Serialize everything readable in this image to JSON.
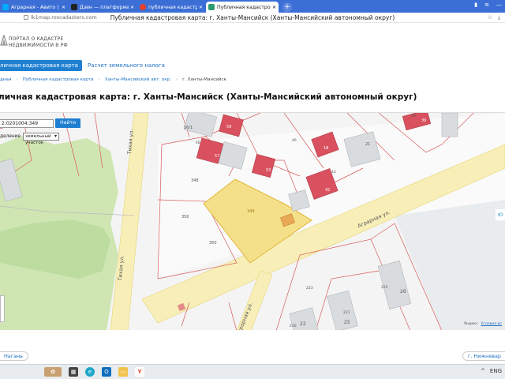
{
  "browser": {
    "tabs": [
      {
        "title": "Аграрная - Авито | Объя",
        "favicon_color": "#00aaff"
      },
      {
        "title": "Дзен — платформа для п",
        "favicon_color": "#222222"
      },
      {
        "title": "публичная кадастровая к",
        "favicon_color": "#e8402c"
      },
      {
        "title": "Публичная кадастровая",
        "favicon_color": "#2e9a6f"
      }
    ],
    "new_tab_symbol": "+",
    "url": "lk1map.roscadasters.com",
    "page_title": "Публичная кадастровая карта: г. Ханты-Мансийск (Ханты-Мансийский автономный округ)"
  },
  "site": {
    "logo_text_line1": "ПОРТАЛ О КАДАСТРЕ",
    "logo_text_line2": "НЕДВИЖИМОСТИ В РФ",
    "nav_active": "личная кадастровая карта",
    "nav_link": "Расчет земельного налога",
    "breadcrumbs": [
      "дная",
      "Публичная кадастровая карта",
      "Ханты-Мансийский авт. окр.",
      "г. Ханты-Мансийск"
    ],
    "title": "личная кадастровая карта: г. Ханты-Мансийск (Ханты-Мансийский автономный округ)"
  },
  "map": {
    "search_value": "2:0201004:349",
    "find_button": "Найти",
    "select_label": "деление",
    "select_value": "земельный участок",
    "parcel_labels": [
      "56/1",
      "59",
      "48",
      "46",
      "57",
      "53",
      "43",
      "42",
      "348",
      "349",
      "350",
      "350",
      "18",
      "21",
      "36",
      "226",
      "223",
      "26",
      "25",
      "22",
      "221",
      "222",
      "16"
    ],
    "streets": [
      "Тихая ул.",
      "Аграрная ул.",
      "Аграрная ул."
    ],
    "right_edge_label": "Ю",
    "attribution_brand": "Яндекс",
    "attribution_link": "Условия ис"
  },
  "footer": {
    "left_pill": "Нагань",
    "right_pill": "г. Нижневар"
  },
  "taskbar": {
    "icons": [
      "photo-icon",
      "task-view-icon",
      "edge-icon",
      "outlook-icon",
      "explorer-icon",
      "yandex-icon"
    ],
    "tray": [
      "^",
      "ENG"
    ]
  },
  "colors": {
    "accent": "#1f7fd1",
    "tab_strip": "#3c6fd6",
    "selected_parcel": "#f5e08a",
    "building": "#d9505f"
  }
}
